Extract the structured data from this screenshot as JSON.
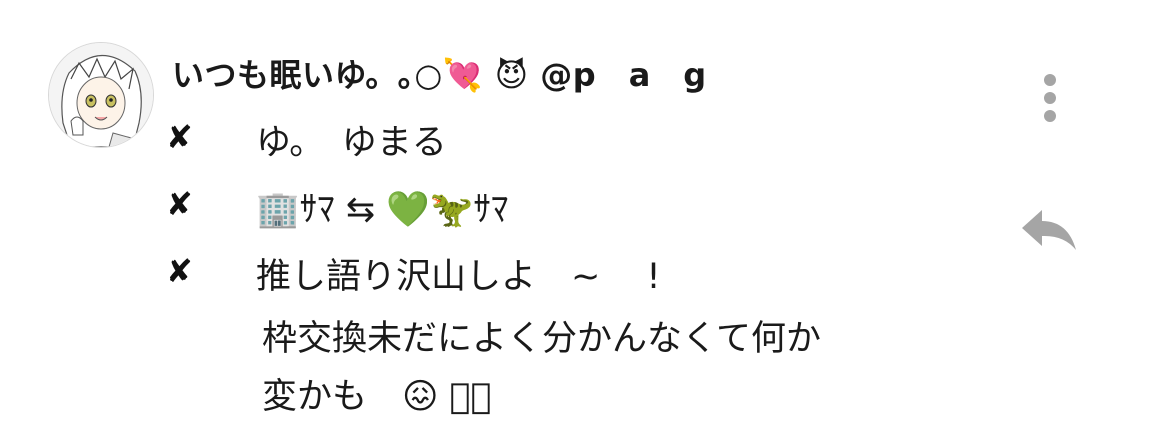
{
  "post": {
    "display_name": "いつも眠いゆ。｡○💘 😈 @p　a　g",
    "lines": [
      {
        "bullet": "✘",
        "text": "ゆ。　ゆまる"
      },
      {
        "bullet": "✘",
        "text": "🏢ｻﾏ ⇆ 💚🦖ｻﾏ"
      },
      {
        "bullet": "✘",
        "text": "推し語り沢山しよ　~　 !"
      }
    ],
    "continuation": [
      "枠交換未だによく分かんなくて何か",
      "変かも　😖 ﾟﾟ"
    ]
  },
  "icons": {
    "avatar": "avatar-image",
    "more": "vertical-dots-icon",
    "reply": "reply-arrow-icon"
  },
  "colors": {
    "text": "#1a1a1a",
    "icon_gray": "#a5a5a5"
  }
}
